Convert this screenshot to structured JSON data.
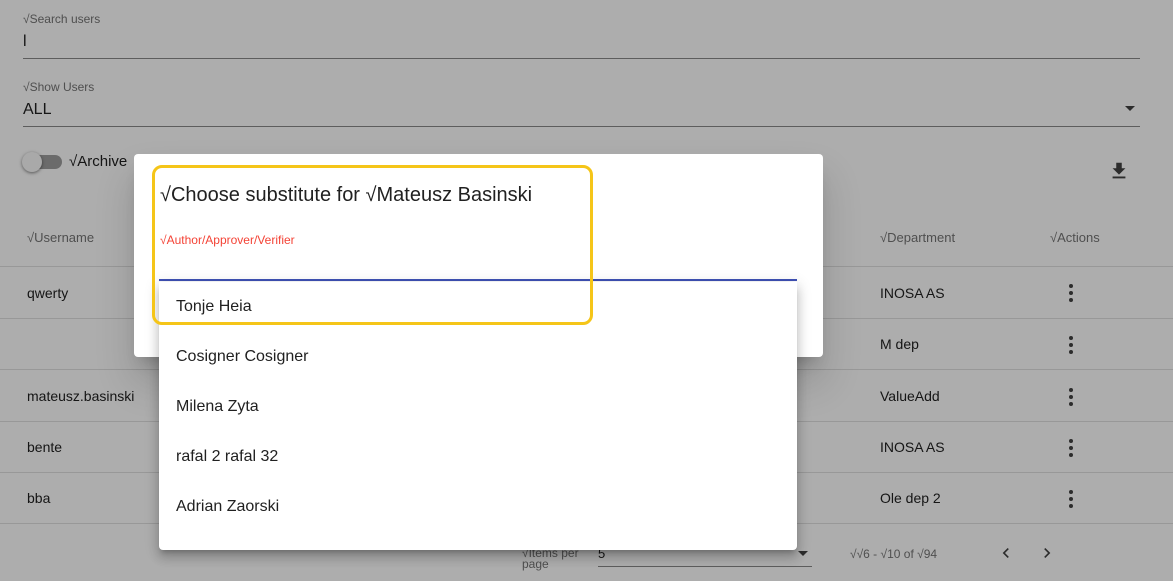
{
  "search": {
    "label": "√Search users",
    "value": "l"
  },
  "show_users": {
    "label": "√Show Users",
    "value": "ALL"
  },
  "archived_toggle": {
    "label": "√Archive"
  },
  "table": {
    "headers": {
      "username": "√Username",
      "department": "√Department",
      "actions": "√Actions"
    },
    "rows": [
      {
        "username": "qwerty",
        "department": "INOSA AS"
      },
      {
        "username": "",
        "department": "M dep"
      },
      {
        "username": "mateusz.basinski",
        "department": "ValueAdd"
      },
      {
        "username": "bente",
        "department": "INOSA AS"
      },
      {
        "username": "bba",
        "department": "Ole dep 2"
      }
    ]
  },
  "paginator": {
    "items_per_page_label": "√Items per page",
    "page_size": "5",
    "range_label": "√√6 - √10 of √94"
  },
  "dialog": {
    "title": "√Choose substitute for √Mateusz Basinski",
    "field_label": "√Author/Approver/Verifier",
    "options": [
      "Tonje Heia",
      "Cosigner Cosigner",
      "Milena Zyta",
      "rafal 2 rafal 32",
      "Adrian Zaorski"
    ]
  },
  "colors": {
    "highlight": "#f5c518",
    "required_label": "#f44336",
    "overlay": "rgba(0,0,0,0.32)"
  },
  "icons": [
    "dropdown-arrow-icon",
    "download-icon",
    "kebab-menu-icon",
    "chevron-left-icon",
    "chevron-right-icon"
  ]
}
